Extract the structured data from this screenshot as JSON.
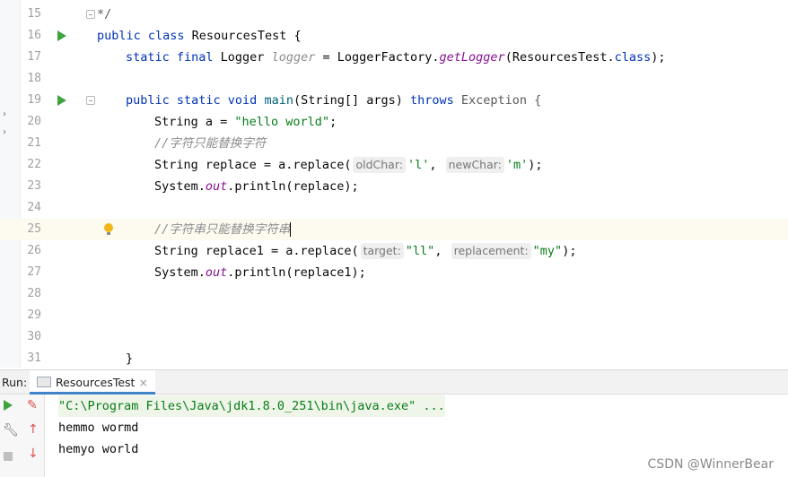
{
  "editor": {
    "lines": [
      {
        "n": "15",
        "parts": [
          {
            "t": "*/",
            "c": "gray"
          }
        ],
        "indent": 0
      },
      {
        "n": "16",
        "parts": [
          {
            "t": "public class ",
            "c": "kw"
          },
          {
            "t": "ResourcesTest {",
            "c": "ty"
          }
        ],
        "indent": 0,
        "run": true
      },
      {
        "n": "17",
        "parts": [
          {
            "t": "static final ",
            "c": "kw"
          },
          {
            "t": "Logger ",
            "c": "ty"
          },
          {
            "t": "logger",
            "c": "it-grey"
          },
          {
            "t": " = LoggerFactory.",
            "c": "ty"
          },
          {
            "t": "getLogger",
            "c": "it"
          },
          {
            "t": "(ResourcesTest.",
            "c": "ty"
          },
          {
            "t": "class",
            "c": "kw"
          },
          {
            "t": ");",
            "c": "ty"
          }
        ],
        "indent": 1
      },
      {
        "n": "18",
        "parts": [],
        "indent": 0
      },
      {
        "n": "19",
        "parts": [
          {
            "t": "public static void ",
            "c": "kw"
          },
          {
            "t": "main",
            "c": "fn"
          },
          {
            "t": "(String[] args) ",
            "c": "ty"
          },
          {
            "t": "throws ",
            "c": "kw"
          },
          {
            "t": "Exception {",
            "c": "gray"
          }
        ],
        "indent": 1,
        "run": true,
        "fold": true
      },
      {
        "n": "20",
        "parts": [
          {
            "t": "String a = ",
            "c": "ty"
          },
          {
            "t": "\"hello world\"",
            "c": "str"
          },
          {
            "t": ";",
            "c": "ty"
          }
        ],
        "indent": 2
      },
      {
        "n": "21",
        "parts": [
          {
            "t": "//字符只能替换字符",
            "c": "cm"
          }
        ],
        "indent": 2
      },
      {
        "n": "22",
        "parts": [
          {
            "t": "String replace = a.replace(",
            "c": "ty"
          },
          {
            "hint": "oldChar:"
          },
          {
            "t": "'l'",
            "c": "str"
          },
          {
            "t": ", ",
            "c": "ty"
          },
          {
            "hint": "newChar:"
          },
          {
            "t": "'m'",
            "c": "str"
          },
          {
            "t": ");",
            "c": "ty"
          }
        ],
        "indent": 2
      },
      {
        "n": "23",
        "parts": [
          {
            "t": "System.",
            "c": "ty"
          },
          {
            "t": "out",
            "c": "it"
          },
          {
            "t": ".println(replace);",
            "c": "ty"
          }
        ],
        "indent": 2
      },
      {
        "n": "24",
        "parts": [],
        "indent": 0
      },
      {
        "n": "25",
        "parts": [
          {
            "t": "//字符串只能替换字符串",
            "c": "cm"
          },
          {
            "caret": true
          }
        ],
        "indent": 2,
        "highlight": true,
        "bulb": true
      },
      {
        "n": "26",
        "parts": [
          {
            "t": "String replace1 = a.replace(",
            "c": "ty"
          },
          {
            "hint": "target:"
          },
          {
            "t": "\"ll\"",
            "c": "str"
          },
          {
            "t": ", ",
            "c": "ty"
          },
          {
            "hint": "replacement:"
          },
          {
            "t": "\"my\"",
            "c": "str"
          },
          {
            "t": ");",
            "c": "ty"
          }
        ],
        "indent": 2
      },
      {
        "n": "27",
        "parts": [
          {
            "t": "System.",
            "c": "ty"
          },
          {
            "t": "out",
            "c": "it"
          },
          {
            "t": ".println(replace1);",
            "c": "ty"
          }
        ],
        "indent": 2
      },
      {
        "n": "28",
        "parts": [],
        "indent": 0
      },
      {
        "n": "29",
        "parts": [],
        "indent": 0
      },
      {
        "n": "30",
        "parts": [],
        "indent": 0
      },
      {
        "n": "31",
        "parts": [
          {
            "t": "}",
            "c": "ty"
          }
        ],
        "indent": 1
      }
    ]
  },
  "run_panel": {
    "label": "Run:",
    "tab_label": "ResourcesTest",
    "tab_close": "×",
    "icons": [
      "rerun-icon",
      "edit-config-icon",
      "wrench-icon",
      "up-icon",
      "down-icon",
      "stop-icon"
    ]
  },
  "console": {
    "command": "\"C:\\Program Files\\Java\\jdk1.8.0_251\\bin\\java.exe\" ...",
    "output": [
      "hemmo wormd",
      "hemyo world"
    ]
  },
  "watermark": "CSDN @WinnerBear",
  "colors": {
    "keyword": "#0033b3",
    "string": "#067d17",
    "comment": "#8c8c8c",
    "run_arrow": "#3fa33f",
    "tab_underline": "#4083c9"
  }
}
